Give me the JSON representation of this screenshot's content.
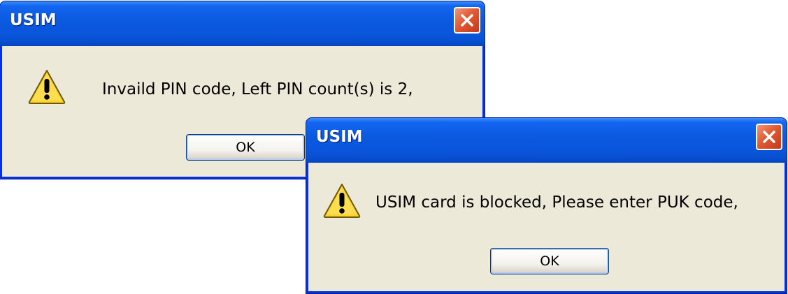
{
  "dialogs": [
    {
      "title": "USIM",
      "message": "Invaild PIN code, Left PIN count(s) is 2,",
      "ok_label": "OK",
      "icon": "warning-icon"
    },
    {
      "title": "USIM",
      "message": "USIM card is blocked, Please enter PUK code,",
      "ok_label": "OK",
      "icon": "warning-icon"
    }
  ],
  "colors": {
    "titlebar": "#0a56dc",
    "window_bg": "#ece9d8",
    "close_button": "#e05a32",
    "warning_yellow": "#ffd42a"
  }
}
